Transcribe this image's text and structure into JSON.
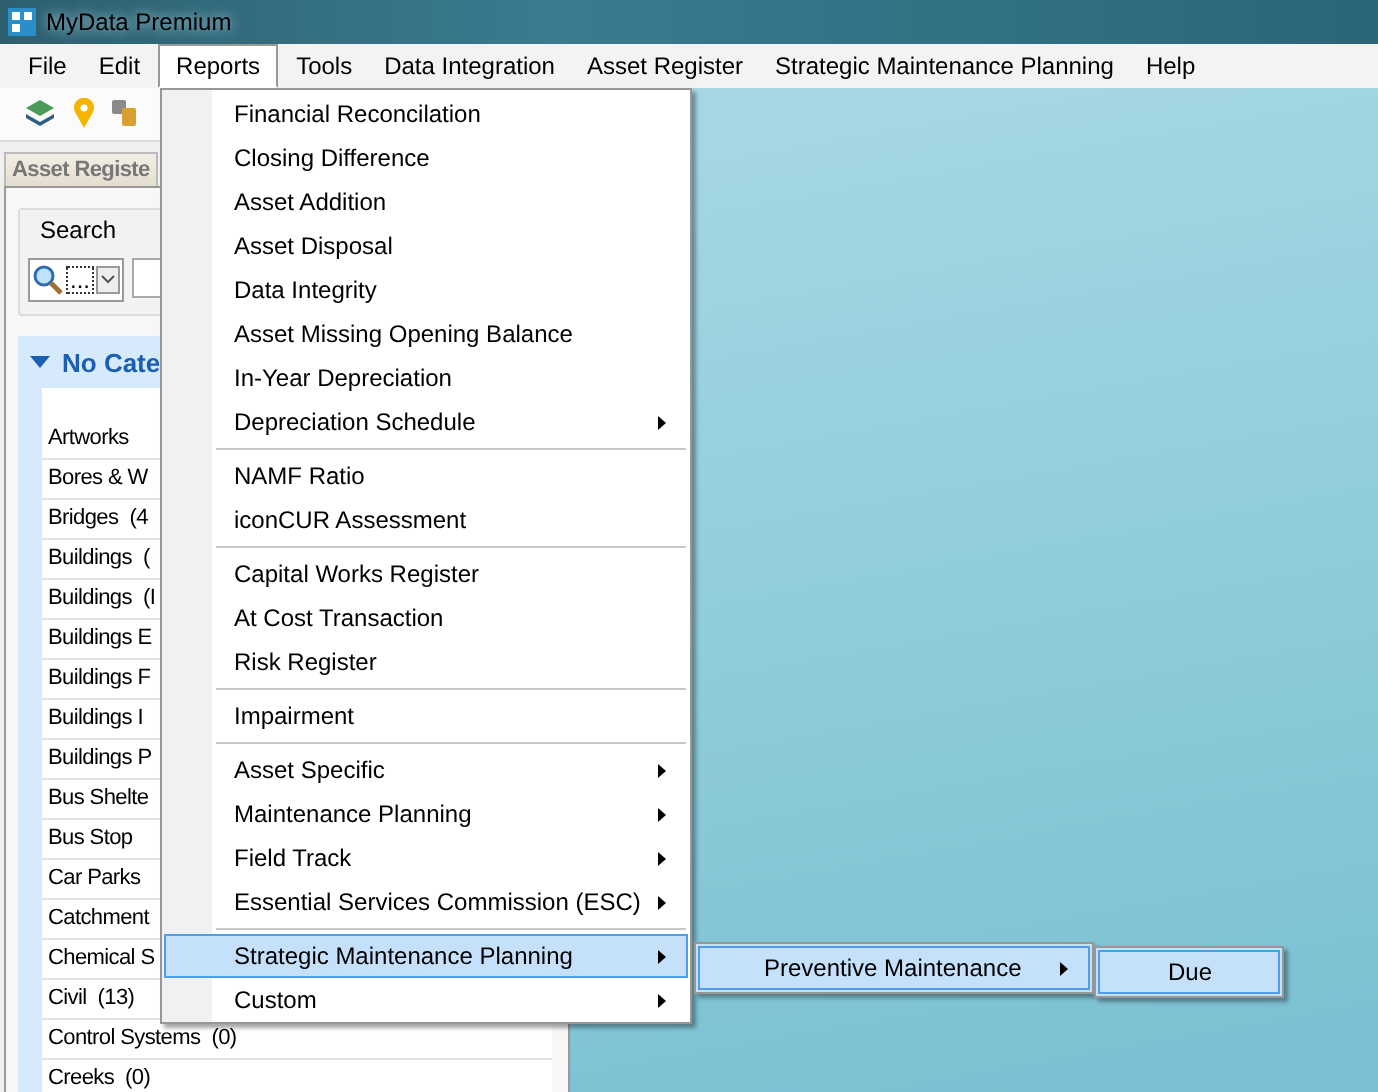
{
  "window": {
    "title": "MyData Premium"
  },
  "menu_bar": [
    {
      "label": "File",
      "selected": false
    },
    {
      "label": "Edit",
      "selected": false
    },
    {
      "label": "Reports",
      "selected": true
    },
    {
      "label": "Tools",
      "selected": false
    },
    {
      "label": "Data Integration",
      "selected": false
    },
    {
      "label": "Asset Register",
      "selected": false
    },
    {
      "label": "Strategic Maintenance Planning",
      "selected": false
    },
    {
      "label": "Help",
      "selected": false
    }
  ],
  "panel": {
    "tab": "Asset Registe",
    "search_header": "Search",
    "search_option": "...",
    "group": {
      "label": "No Cate",
      "expanded": true
    },
    "items": [
      "Artworks",
      "Bores & W",
      "Bridges  (4",
      "Buildings  (",
      "Buildings  (I",
      "Buildings E",
      "Buildings F",
      "Buildings I",
      "Buildings P",
      "Bus Shelte",
      "Bus Stop",
      "Car Parks",
      "Catchment",
      "Chemical S",
      "Civil  (13)",
      "Control Systems  (0)",
      "Creeks  (0)"
    ]
  },
  "reports_menu": {
    "sections": [
      [
        {
          "label": "Financial Reconcilation",
          "submenu": false,
          "selected": false
        },
        {
          "label": "Closing Difference",
          "submenu": false,
          "selected": false
        },
        {
          "label": "Asset Addition",
          "submenu": false,
          "selected": false
        },
        {
          "label": "Asset Disposal",
          "submenu": false,
          "selected": false
        },
        {
          "label": "Data Integrity",
          "submenu": false,
          "selected": false
        },
        {
          "label": "Asset Missing Opening Balance",
          "submenu": false,
          "selected": false
        },
        {
          "label": "In-Year Depreciation",
          "submenu": false,
          "selected": false
        },
        {
          "label": "Depreciation Schedule",
          "submenu": true,
          "selected": false
        }
      ],
      [
        {
          "label": "NAMF Ratio",
          "submenu": false,
          "selected": false
        },
        {
          "label": "iconCUR Assessment",
          "submenu": false,
          "selected": false
        }
      ],
      [
        {
          "label": "Capital Works Register",
          "submenu": false,
          "selected": false
        },
        {
          "label": "At Cost Transaction",
          "submenu": false,
          "selected": false
        },
        {
          "label": "Risk Register",
          "submenu": false,
          "selected": false
        }
      ],
      [
        {
          "label": "Impairment",
          "submenu": false,
          "selected": false
        }
      ],
      [
        {
          "label": "Asset Specific",
          "submenu": true,
          "selected": false
        },
        {
          "label": "Maintenance Planning",
          "submenu": true,
          "selected": false
        },
        {
          "label": "Field Track",
          "submenu": true,
          "selected": false
        },
        {
          "label": "Essential Services Commission (ESC)",
          "submenu": true,
          "selected": false
        }
      ],
      [
        {
          "label": "Strategic Maintenance Planning",
          "submenu": true,
          "selected": true
        },
        {
          "label": "Custom",
          "submenu": true,
          "selected": false
        }
      ]
    ]
  },
  "submenu_1": [
    {
      "label": "Preventive Maintenance",
      "submenu": true,
      "selected": true
    }
  ],
  "submenu_2": [
    {
      "label": "Due",
      "submenu": false,
      "selected": true
    }
  ]
}
